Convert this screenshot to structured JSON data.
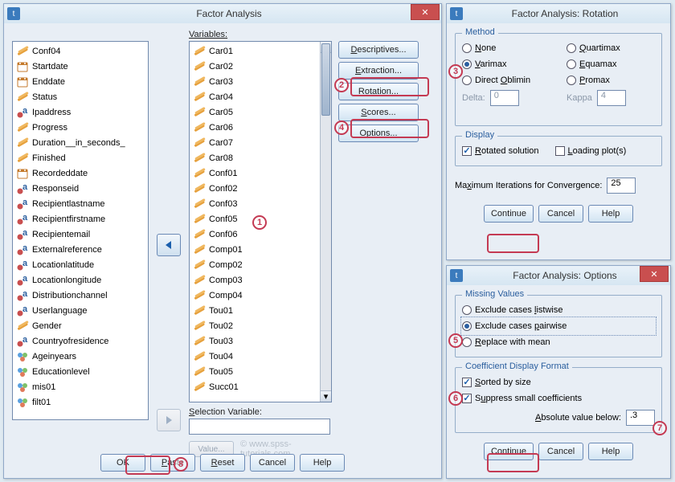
{
  "main": {
    "title": "Factor Analysis",
    "close_glyph": "✕",
    "vars_label": "Variables:",
    "selection_label": "Selection Variable:",
    "watermark": "© www.spss-tutorials.com",
    "left_list": [
      {
        "t": "num",
        "name": "Conf04"
      },
      {
        "t": "date",
        "name": "Startdate"
      },
      {
        "t": "date",
        "name": "Enddate"
      },
      {
        "t": "num",
        "name": "Status"
      },
      {
        "t": "str",
        "name": "Ipaddress"
      },
      {
        "t": "num",
        "name": "Progress"
      },
      {
        "t": "num",
        "name": "Duration__in_seconds_"
      },
      {
        "t": "num",
        "name": "Finished"
      },
      {
        "t": "date",
        "name": "Recordeddate"
      },
      {
        "t": "str",
        "name": "Responseid"
      },
      {
        "t": "str",
        "name": "Recipientlastname"
      },
      {
        "t": "str",
        "name": "Recipientfirstname"
      },
      {
        "t": "str",
        "name": "Recipientemail"
      },
      {
        "t": "str",
        "name": "Externalreference"
      },
      {
        "t": "str",
        "name": "Locationlatitude"
      },
      {
        "t": "str",
        "name": "Locationlongitude"
      },
      {
        "t": "str",
        "name": "Distributionchannel"
      },
      {
        "t": "str",
        "name": "Userlanguage"
      },
      {
        "t": "num",
        "name": "Gender"
      },
      {
        "t": "str",
        "name": "Countryofresidence"
      },
      {
        "t": "nom",
        "name": "Ageinyears"
      },
      {
        "t": "nom",
        "name": "Educationlevel"
      },
      {
        "t": "nom",
        "name": "mis01"
      },
      {
        "t": "nom",
        "name": "filt01"
      }
    ],
    "right_list": [
      {
        "t": "num",
        "name": "Car01"
      },
      {
        "t": "num",
        "name": "Car02"
      },
      {
        "t": "num",
        "name": "Car03"
      },
      {
        "t": "num",
        "name": "Car04"
      },
      {
        "t": "num",
        "name": "Car05"
      },
      {
        "t": "num",
        "name": "Car06"
      },
      {
        "t": "num",
        "name": "Car07"
      },
      {
        "t": "num",
        "name": "Car08"
      },
      {
        "t": "num",
        "name": "Conf01"
      },
      {
        "t": "num",
        "name": "Conf02"
      },
      {
        "t": "num",
        "name": "Conf03"
      },
      {
        "t": "num",
        "name": "Conf05"
      },
      {
        "t": "num",
        "name": "Conf06"
      },
      {
        "t": "num",
        "name": "Comp01"
      },
      {
        "t": "num",
        "name": "Comp02"
      },
      {
        "t": "num",
        "name": "Comp03"
      },
      {
        "t": "num",
        "name": "Comp04"
      },
      {
        "t": "num",
        "name": "Tou01"
      },
      {
        "t": "num",
        "name": "Tou02"
      },
      {
        "t": "num",
        "name": "Tou03"
      },
      {
        "t": "num",
        "name": "Tou04"
      },
      {
        "t": "num",
        "name": "Tou05"
      },
      {
        "t": "num",
        "name": "Succ01"
      }
    ],
    "sidebtns": {
      "descriptives": "Descriptives...",
      "extraction": "Extraction...",
      "rotation": "Rotation...",
      "scores": "Scores...",
      "options": "Options..."
    },
    "bottom": {
      "value": "Value...",
      "ok": "OK",
      "paste": "Paste",
      "reset": "Reset",
      "cancel": "Cancel",
      "help": "Help"
    }
  },
  "rotation": {
    "title": "Factor Analysis: Rotation",
    "method_legend": "Method",
    "radios": {
      "none": "None",
      "varimax": "Varimax",
      "direct": "Direct Oblimin",
      "quartimax": "Quartimax",
      "equamax": "Equamax",
      "promax": "Promax"
    },
    "delta_lbl": "Delta:",
    "delta_val": "0",
    "kappa_lbl": "Kappa",
    "kappa_val": "4",
    "display_legend": "Display",
    "checks": {
      "rotated": "Rotated solution",
      "loading": "Loading plot(s)"
    },
    "maxiter_lbl": "Maximum Iterations for Convergence:",
    "maxiter_val": "25",
    "btns": {
      "continue": "Continue",
      "cancel": "Cancel",
      "help": "Help"
    }
  },
  "options": {
    "title": "Factor Analysis: Options",
    "missing_legend": "Missing Values",
    "radios": {
      "listwise": "Exclude cases listwise",
      "pairwise": "Exclude cases pairwise",
      "mean": "Replace with mean"
    },
    "coef_legend": "Coefficient Display Format",
    "checks": {
      "sorted": "Sorted by size",
      "suppress": "Suppress small coefficients"
    },
    "abs_lbl": "Absolute value below:",
    "abs_val": ".3",
    "btns": {
      "continue": "Continue",
      "cancel": "Cancel",
      "help": "Help"
    }
  },
  "markers": {
    "1": "1",
    "2": "2",
    "3": "3",
    "4": "4",
    "5": "5",
    "6": "6",
    "7": "7",
    "8": "8"
  }
}
